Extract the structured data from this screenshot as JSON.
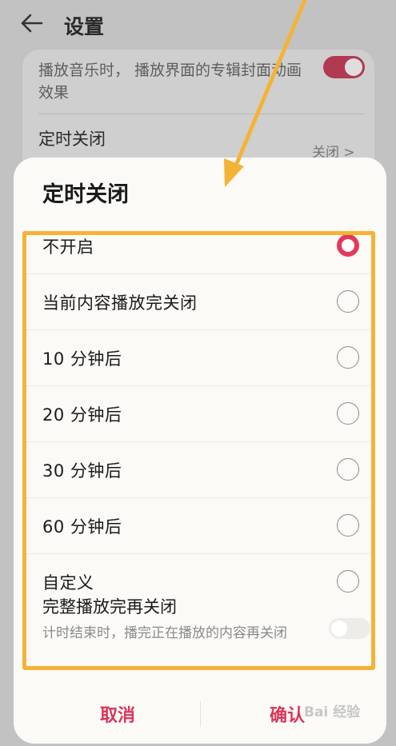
{
  "background": {
    "header": {
      "title": "设置"
    },
    "animation_setting": {
      "description": "播放音乐时， 播放界面的专辑封面动画效果"
    },
    "timer_setting": {
      "label": "定时关闭",
      "value": "关闭 >"
    }
  },
  "dialog": {
    "title": "定时关闭",
    "options": [
      {
        "label": "不开启",
        "selected": true
      },
      {
        "label": "当前内容播放完关闭",
        "selected": false
      },
      {
        "label": "10 分钟后",
        "selected": false
      },
      {
        "label": "20 分钟后",
        "selected": false
      },
      {
        "label": "30 分钟后",
        "selected": false
      },
      {
        "label": "60 分钟后",
        "selected": false
      },
      {
        "label": "自定义",
        "selected": false
      }
    ],
    "full_play": {
      "title": "完整播放完再关闭",
      "description": "计时结束时，播完正在播放的内容再关闭"
    },
    "buttons": {
      "cancel": "取消",
      "confirm": "确认"
    }
  },
  "watermark": "Bai 经验",
  "colors": {
    "accent": "#e2395c",
    "highlight": "#f5b335",
    "toggle_on": "#b03a52"
  },
  "icons": {
    "back": "arrow-left-icon",
    "radio_selected": "radio-selected-icon",
    "radio_unselected": "radio-unselected-icon"
  }
}
